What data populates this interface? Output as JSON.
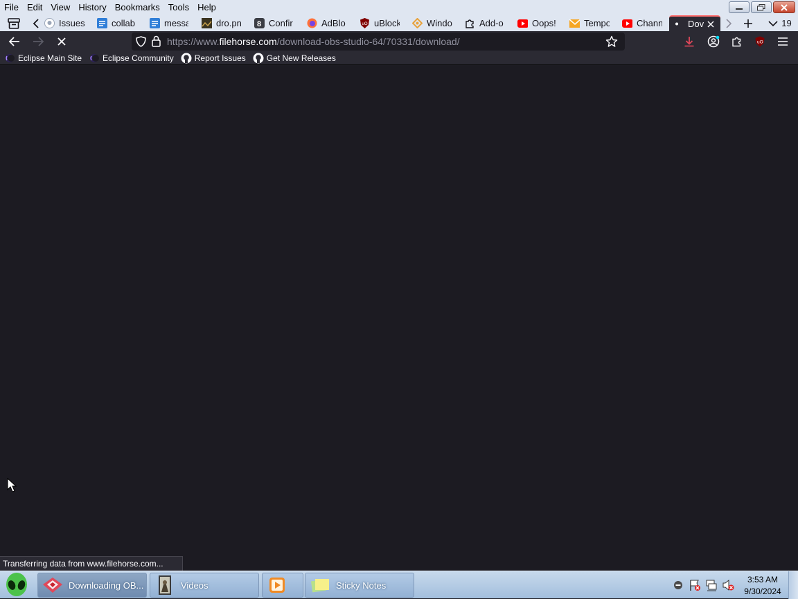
{
  "menubar": {
    "items": [
      "File",
      "Edit",
      "View",
      "History",
      "Bookmarks",
      "Tools",
      "Help"
    ]
  },
  "tabs": [
    {
      "title": "Issues",
      "icon": "github-icon"
    },
    {
      "title": "collab",
      "icon": "doc-icon"
    },
    {
      "title": "messa",
      "icon": "doc-icon"
    },
    {
      "title": "dro.pn",
      "icon": "image-icon"
    },
    {
      "title": "Confir",
      "icon": "b-icon"
    },
    {
      "title": "AdBlo",
      "icon": "firefox-icon"
    },
    {
      "title": "uBlock",
      "icon": "ublock-icon"
    },
    {
      "title": "Windo",
      "icon": "diamond-icon"
    },
    {
      "title": "Add-o",
      "icon": "puzzle-icon"
    },
    {
      "title": "Oops!",
      "icon": "youtube-icon"
    },
    {
      "title": "Tempo",
      "icon": "mail-icon"
    },
    {
      "title": "Chann",
      "icon": "youtube-icon"
    },
    {
      "title": "Dov",
      "icon": "loading-dot-icon",
      "active": true
    }
  ],
  "tab_count": "19",
  "navbar": {
    "url_prefix": "https://www.",
    "url_domain": "filehorse.com",
    "url_path": "/download-obs-studio-64/70331/download/"
  },
  "bookmarks": [
    {
      "label": "Eclipse Main Site",
      "icon": "eclipse-icon"
    },
    {
      "label": "Eclipse Community",
      "icon": "eclipse-icon"
    },
    {
      "label": "Report Issues",
      "icon": "github-icon"
    },
    {
      "label": "Get New Releases",
      "icon": "github-icon"
    }
  ],
  "status": "Transferring data from www.filehorse.com...",
  "taskbar": {
    "tasks": [
      {
        "label": "Downloading OB...",
        "icon": "browser-icon",
        "active": true
      },
      {
        "label": "Videos",
        "icon": "video-folder-icon"
      },
      {
        "label": "",
        "icon": "media-player-icon"
      },
      {
        "label": "Sticky Notes",
        "icon": "sticky-notes-icon"
      }
    ],
    "time": "3:53 AM",
    "date": "9/30/2024"
  },
  "colors": {
    "chrome_dark": "#2b2a33",
    "content_bg": "#1c1b22",
    "chrome_light": "#dfe6f1",
    "accent_red": "#ff6f6f"
  }
}
